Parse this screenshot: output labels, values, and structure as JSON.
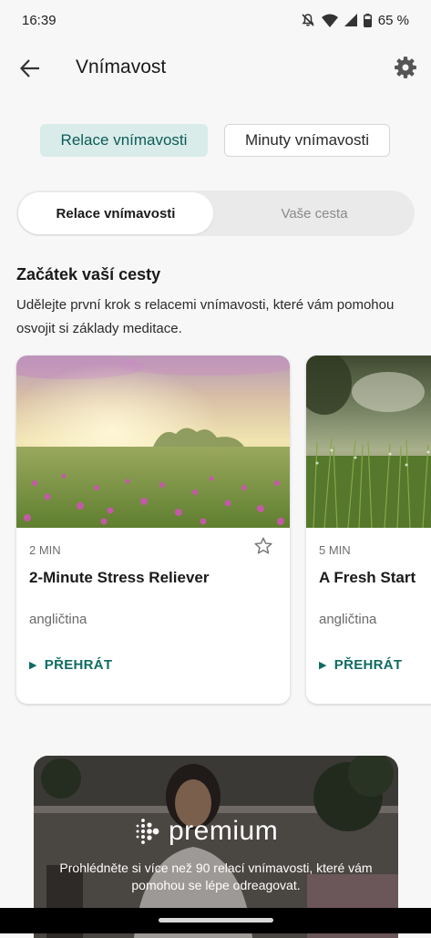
{
  "status": {
    "time": "16:39",
    "battery": "65 %"
  },
  "header": {
    "title": "Vnímavost"
  },
  "filters": [
    {
      "label": "Relace vnímavosti",
      "selected": true
    },
    {
      "label": "Minuty vnímavosti",
      "selected": false
    }
  ],
  "segments": [
    {
      "label": "Relace vnímavosti",
      "selected": true
    },
    {
      "label": "Vaše cesta",
      "selected": false
    }
  ],
  "section": {
    "title": "Začátek vaší cesty",
    "description": "Udělejte první krok s relacemi vnímavosti, které vám pomohou osvojit si základy meditace."
  },
  "cards": [
    {
      "duration": "2 MIN",
      "title": "2-Minute Stress Reliever",
      "language": "angličtina",
      "action": "PŘEHRÁT",
      "favorite": false
    },
    {
      "duration": "5 MIN",
      "title": "A Fresh Start",
      "language": "angličtina",
      "action": "PŘEHRÁT"
    }
  ],
  "premium": {
    "brand": "premium",
    "text": "Prohlédněte si více než 90 relací vnímavosti, které vám pomohou se lépe odreagovat."
  },
  "colors": {
    "accent": "#0f6b63",
    "chip_selected_bg": "#d9ecea",
    "background": "#f7f7f7"
  },
  "icons": [
    "mute-icon",
    "wifi-icon",
    "signal-icon",
    "battery-icon",
    "back-arrow-icon",
    "gear-icon",
    "star-icon",
    "play-icon",
    "fitbit-logo-icon"
  ]
}
